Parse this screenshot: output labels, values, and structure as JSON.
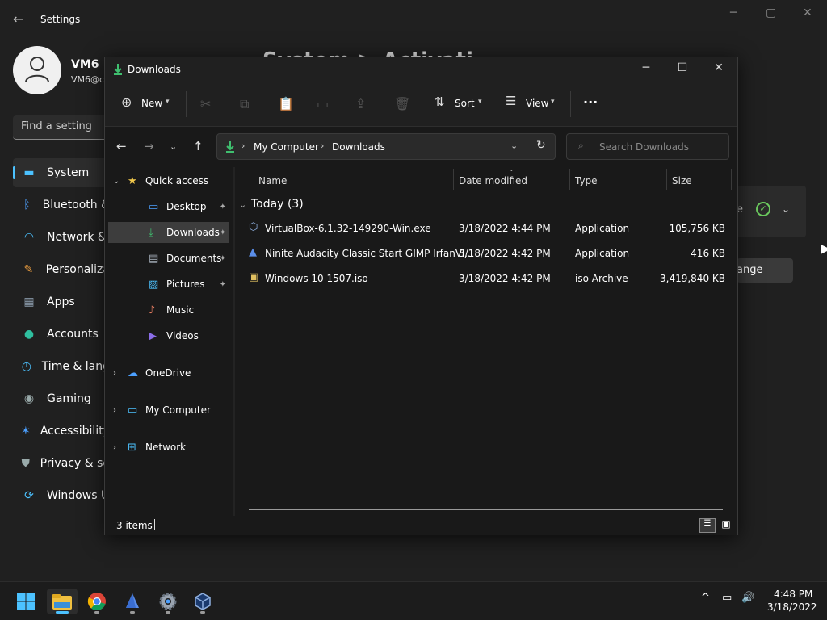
{
  "settings": {
    "title": "Settings",
    "user_name": "VM6",
    "user_email": "VM6@c",
    "search_placeholder": "Find a setting",
    "page_heading": "System > Activati",
    "panel_status_fragment": "e",
    "change_button": "ange",
    "nav": [
      {
        "label": "System",
        "icon": "monitor-icon",
        "color": "#4cc2ff"
      },
      {
        "label": "Bluetooth &",
        "icon": "bluetooth-icon",
        "color": "#4ca0ff"
      },
      {
        "label": "Network &",
        "icon": "wifi-icon",
        "color": "#4cc2ff"
      },
      {
        "label": "Personaliza",
        "icon": "brush-icon",
        "color": "#f0a040"
      },
      {
        "label": "Apps",
        "icon": "apps-icon",
        "color": "#8a9aaa"
      },
      {
        "label": "Accounts",
        "icon": "person-icon",
        "color": "#2fbf9f"
      },
      {
        "label": "Time & lang",
        "icon": "clock-icon",
        "color": "#4cc2ff"
      },
      {
        "label": "Gaming",
        "icon": "gamepad-icon",
        "color": "#9aa"
      },
      {
        "label": "Accessibility",
        "icon": "accessibility-icon",
        "color": "#4ca0ff"
      },
      {
        "label": "Privacy & se",
        "icon": "shield-icon",
        "color": "#9aa"
      },
      {
        "label": "Windows U",
        "icon": "update-icon",
        "color": "#4cc2ff"
      }
    ]
  },
  "explorer": {
    "title": "Downloads",
    "toolbar": {
      "new": "New",
      "sort": "Sort",
      "view": "View",
      "more": "..."
    },
    "address": {
      "root": "My Computer",
      "current": "Downloads"
    },
    "search_placeholder": "Search Downloads",
    "tree": [
      {
        "label": "Quick access",
        "icon": "star-icon",
        "level": 0,
        "expand": "v"
      },
      {
        "label": "Desktop",
        "icon": "desktop-folder-icon",
        "level": 1,
        "pinned": true
      },
      {
        "label": "Downloads",
        "icon": "download-folder-icon",
        "level": 1,
        "pinned": true,
        "selected": true
      },
      {
        "label": "Documents",
        "icon": "documents-folder-icon",
        "level": 1,
        "pinned": true
      },
      {
        "label": "Pictures",
        "icon": "pictures-folder-icon",
        "level": 1,
        "pinned": true
      },
      {
        "label": "Music",
        "icon": "music-folder-icon",
        "level": 1
      },
      {
        "label": "Videos",
        "icon": "videos-folder-icon",
        "level": 1
      },
      {
        "label": "OneDrive",
        "icon": "cloud-icon",
        "level": 0,
        "expand": ">"
      },
      {
        "label": "My Computer",
        "icon": "computer-icon",
        "level": 0,
        "expand": ">"
      },
      {
        "label": "Network",
        "icon": "network-icon",
        "level": 0,
        "expand": ">"
      }
    ],
    "columns": [
      "Name",
      "Date modified",
      "Type",
      "Size"
    ],
    "group_label": "Today (3)",
    "files": [
      {
        "name": "VirtualBox-6.1.32-149290-Win.exe",
        "date": "3/18/2022 4:44 PM",
        "type": "Application",
        "size": "105,756 KB",
        "icon": "virtualbox-icon"
      },
      {
        "name": "Ninite Audacity Classic Start GIMP IrfanVi...",
        "date": "3/18/2022 4:42 PM",
        "type": "Application",
        "size": "416 KB",
        "icon": "ninite-icon"
      },
      {
        "name": "Windows 10 1507.iso",
        "date": "3/18/2022 4:42 PM",
        "type": "iso Archive",
        "size": "3,419,840 KB",
        "icon": "iso-icon"
      }
    ],
    "status": "3 items"
  },
  "taskbar": {
    "apps": [
      "windows-start-icon",
      "file-explorer-icon",
      "chrome-icon",
      "ninite-icon",
      "settings-gear-icon",
      "virtualbox-icon"
    ],
    "time": "4:48 PM",
    "date": "3/18/2022"
  }
}
